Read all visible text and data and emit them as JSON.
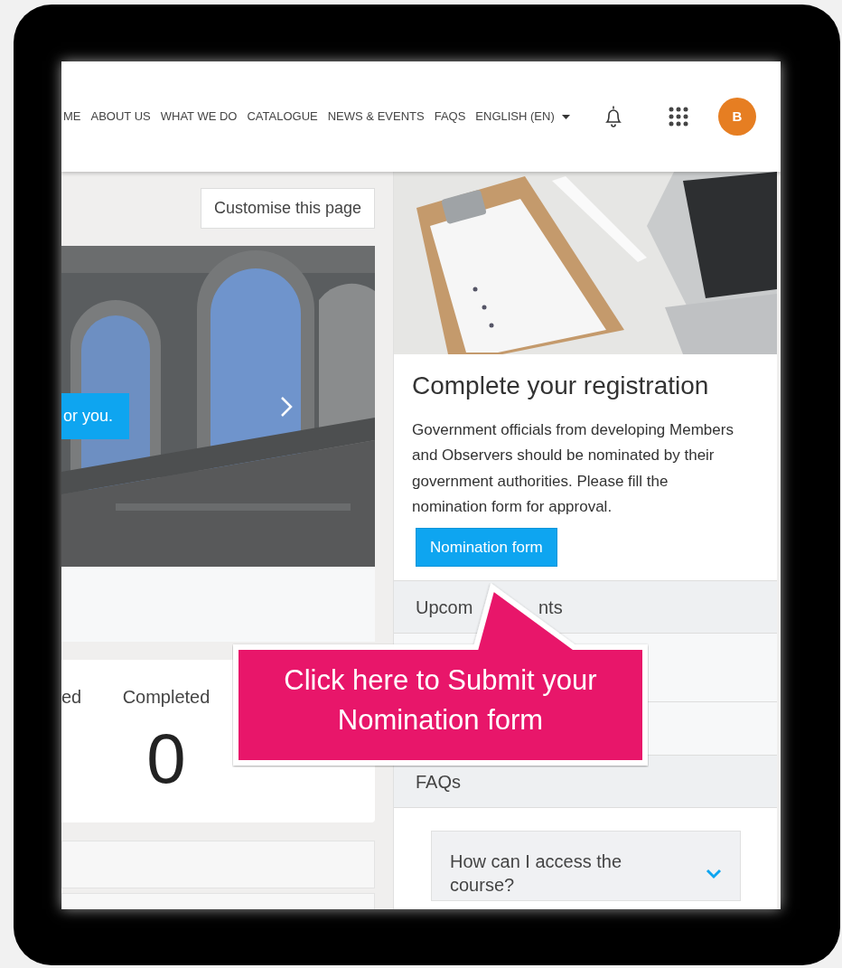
{
  "nav": {
    "items": [
      {
        "label": "ME"
      },
      {
        "label": "ABOUT US"
      },
      {
        "label": "WHAT WE DO"
      },
      {
        "label": "CATALOGUE"
      },
      {
        "label": "NEWS & EVENTS"
      },
      {
        "label": "FAQS"
      }
    ],
    "language": "ENGLISH (EN)",
    "avatar": "B"
  },
  "customise_button": "Customise this page",
  "carousel": {
    "caption": "or you."
  },
  "stats": [
    {
      "label": "ed"
    },
    {
      "label": "Completed",
      "value": "0"
    }
  ],
  "registration": {
    "title": "Complete your registration",
    "text": "Government officials from developing Members and Observers should be nominated by their government authorities. Please fill the nomination form for approval.",
    "button": "Nomination form"
  },
  "upcoming_header": {
    "visible_parts": [
      "Upcom",
      "nts"
    ]
  },
  "faqs_header": "FAQs",
  "faq_items": [
    {
      "question": "How can I access the course?",
      "expanded": false
    }
  ],
  "callout": {
    "text": "Click here to Submit your Nomination form"
  }
}
